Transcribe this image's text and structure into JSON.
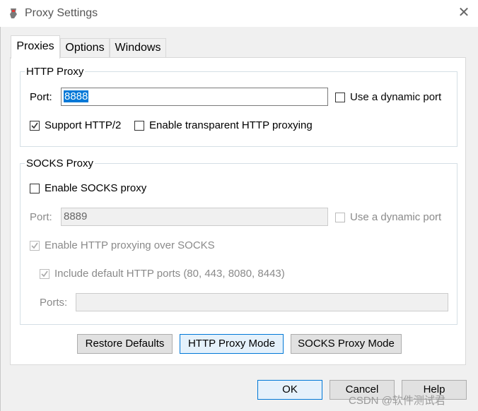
{
  "window": {
    "title": "Proxy Settings",
    "close_glyph": "✕"
  },
  "tabs": [
    {
      "label": "Proxies",
      "active": true
    },
    {
      "label": "Options",
      "active": false
    },
    {
      "label": "Windows",
      "active": false
    }
  ],
  "http_proxy": {
    "group_label": "HTTP Proxy",
    "port_label": "Port:",
    "port_value": "8888",
    "dynamic_port_label": "Use a dynamic port",
    "dynamic_port_checked": false,
    "support_http2_label": "Support HTTP/2",
    "support_http2_checked": true,
    "transparent_label": "Enable transparent HTTP proxying",
    "transparent_checked": false
  },
  "socks_proxy": {
    "group_label": "SOCKS Proxy",
    "enable_label": "Enable SOCKS proxy",
    "enable_checked": false,
    "port_label": "Port:",
    "port_value": "8889",
    "dynamic_port_label": "Use a dynamic port",
    "http_over_socks_label": "Enable HTTP proxying over SOCKS",
    "http_over_socks_checked": true,
    "include_ports_label": "Include default HTTP ports (80, 443, 8080, 8443)",
    "include_ports_checked": true,
    "ports_label": "Ports:",
    "ports_value": ""
  },
  "mode_buttons": {
    "restore": "Restore Defaults",
    "http_mode": "HTTP Proxy Mode",
    "socks_mode": "SOCKS Proxy Mode"
  },
  "dialog_buttons": {
    "ok": "OK",
    "cancel": "Cancel",
    "help": "Help"
  },
  "watermark": "CSDN @软件测试君",
  "colors": {
    "accent": "#0078d7",
    "panel": "#ffffff",
    "window": "#f0f0f0"
  }
}
